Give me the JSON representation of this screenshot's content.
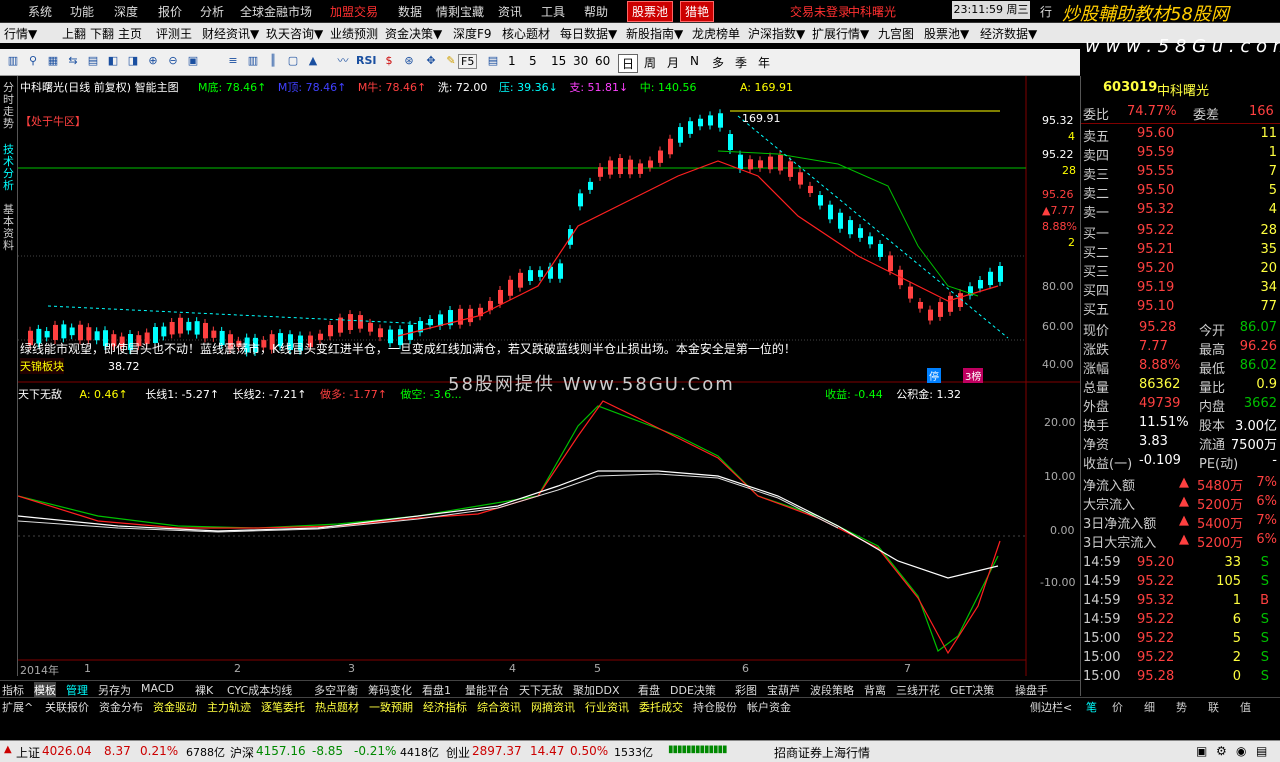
{
  "menubar": {
    "items": [
      "系统",
      "功能",
      "深度",
      "报价",
      "分析",
      "全球金融市场",
      "加盟交易",
      "数据",
      "情剩宝藏",
      "资讯",
      "工具",
      "帮助"
    ],
    "tab_stockpool": "股票池",
    "tab_hunt": "猎艳",
    "status_text": "交易未登录",
    "stock_label": "中科曙光",
    "clock": "23:11:59 周三",
    "trade": "行"
  },
  "toolbar1": [
    "行情▼",
    "上翻",
    "下翻",
    "主页",
    "评测王",
    "财经资讯▼",
    "玖天咨询▼",
    "业绩预测",
    "资金决策▼",
    "深度F9",
    "核心题材",
    "每日数据▼",
    "新股指南▼",
    "龙虎榜单",
    "沪深指数▼",
    "扩展行情▼",
    "九宫图",
    "股票池▼",
    "经济数据▼"
  ],
  "toolbar2": {
    "icons": [
      "chart-bar-icon",
      "search-icon",
      "grid-icon",
      "swap-icon",
      "line-icon",
      "rsi-icon",
      "dollar-icon",
      "target-icon",
      "cross-icon",
      "pencil-icon",
      "f5-icon",
      "doc-icon"
    ],
    "rsi": "RSI",
    "f5": "F5",
    "periods": [
      "1",
      "5",
      "15",
      "30",
      "60",
      "日",
      "周",
      "月",
      "N",
      "多",
      "季",
      "年"
    ]
  },
  "lefttabs": [
    "分时走势",
    "技术分析",
    "基本资料"
  ],
  "chart": {
    "header": "中科曙光(日线 前复权) 智能主图",
    "indicators": [
      {
        "label": "M底: 78.46↑",
        "color": "#00ff00"
      },
      {
        "label": "M顶: 78.46↑",
        "color": "#4040ff"
      },
      {
        "label": "M牛: 78.46↑",
        "color": "#ff4040"
      },
      {
        "label": "洗: 72.00",
        "color": "#ffffff"
      },
      {
        "label": "压: 39.36↓",
        "color": "#00ffff"
      },
      {
        "label": "支: 51.81↓",
        "color": "#ff40ff"
      },
      {
        "label": "中: 140.56",
        "color": "#00ff00"
      },
      {
        "label": "A: 169.91",
        "color": "#ffff00"
      }
    ],
    "bear_tag": "【处于牛区】",
    "peak_label": "169.91",
    "comment": "绿线能市观望，即使冒头也不动！蓝线震荡市，K线冒头变红进半仓，一旦变成红线加满仓，若又跌破蓝线则半仓止损出场。本金安全是第一位的！",
    "sector_label": "天锦板块",
    "low_label": "38.72",
    "watermark": "58股网提供  Www.58GU.Com",
    "right_axis": [
      "95.32",
      "4",
      "95.22",
      "28",
      "95.26",
      "▲7.77",
      "8.88%",
      "2",
      "80.00",
      "60.00",
      "40.00"
    ],
    "sub_header": "天下无敌",
    "sub_indicators": [
      {
        "label": "A: 0.46↑",
        "color": "#ffff00"
      },
      {
        "label": "长线1: -5.27↑",
        "color": "#ffffff"
      },
      {
        "label": "长线2: -7.21↑",
        "color": "#ffffff"
      },
      {
        "label": "做多: -1.77↑",
        "color": "#ff4040"
      },
      {
        "label": "做空: -3.6...",
        "color": "#00ff00"
      },
      {
        "label": "收益: -0.44",
        "color": "#00ff00"
      },
      {
        "label": "公积金: 1.32",
        "color": "#ffffff"
      }
    ],
    "sub_axis": [
      "20.00",
      "10.00",
      "0.00",
      "-10.00"
    ],
    "x_axis": [
      "2014年",
      "1",
      "2",
      "3",
      "4",
      "5",
      "6",
      "7"
    ],
    "ting_label": "停",
    "tag_3": "3榜"
  },
  "rpanel": {
    "code": "603019",
    "name": "中科曙光",
    "ratio_label": "委比",
    "ratio_value": "74.77%",
    "diff_label": "委差",
    "diff_value": "166",
    "asks": [
      {
        "label": "卖五",
        "price": "95.60",
        "vol": "11"
      },
      {
        "label": "卖四",
        "price": "95.59",
        "vol": "1"
      },
      {
        "label": "卖三",
        "price": "95.55",
        "vol": "7"
      },
      {
        "label": "卖二",
        "price": "95.50",
        "vol": "5"
      },
      {
        "label": "卖一",
        "price": "95.32",
        "vol": "4"
      }
    ],
    "bids": [
      {
        "label": "买一",
        "price": "95.22",
        "vol": "28"
      },
      {
        "label": "买二",
        "price": "95.21",
        "vol": "35"
      },
      {
        "label": "买三",
        "price": "95.20",
        "vol": "20"
      },
      {
        "label": "买四",
        "price": "95.19",
        "vol": "34"
      },
      {
        "label": "买五",
        "price": "95.10",
        "vol": "77"
      }
    ],
    "stats": [
      {
        "l1": "现价",
        "v1": "95.28",
        "c1": "#ff4040",
        "l2": "今开",
        "v2": "86.07",
        "c2": "#00c000"
      },
      {
        "l1": "涨跌",
        "v1": "7.77",
        "c1": "#ff4040",
        "l2": "最高",
        "v2": "96.26",
        "c2": "#ff4040"
      },
      {
        "l1": "涨幅",
        "v1": "8.88%",
        "c1": "#ff4040",
        "l2": "最低",
        "v2": "86.02",
        "c2": "#00c000"
      },
      {
        "l1": "总量",
        "v1": "86362",
        "c1": "#ffff40",
        "l2": "量比",
        "v2": "0.9",
        "c2": "#ffff40"
      },
      {
        "l1": "外盘",
        "v1": "49739",
        "c1": "#ff4040",
        "l2": "内盘",
        "v2": "3662",
        "c2": "#00c000"
      },
      {
        "l1": "换手",
        "v1": "11.51%",
        "c1": "#ffffff",
        "l2": "股本",
        "v2": "3.00亿",
        "c2": "#ffffff"
      },
      {
        "l1": "净资",
        "v1": "3.83",
        "c1": "#ffffff",
        "l2": "流通",
        "v2": "7500万",
        "c2": "#ffffff"
      },
      {
        "l1": "收益(一)",
        "v1": "-0.109",
        "c1": "#ffffff",
        "l2": "PE(动)",
        "v2": "-",
        "c2": "#ffffff"
      }
    ],
    "flows": [
      {
        "label": "净流入额",
        "value": "5480万",
        "pct": "7%"
      },
      {
        "label": "大宗流入",
        "value": "5200万",
        "pct": "6%"
      },
      {
        "label": "3日净流入额",
        "value": "5400万",
        "pct": "7%"
      },
      {
        "label": "3日大宗流入",
        "value": "5200万",
        "pct": "6%"
      }
    ],
    "ticks": [
      {
        "time": "14:59",
        "price": "95.20",
        "vol": "33",
        "side": "S"
      },
      {
        "time": "14:59",
        "price": "95.22",
        "vol": "105",
        "side": "S"
      },
      {
        "time": "14:59",
        "price": "95.32",
        "vol": "1",
        "side": "B"
      },
      {
        "time": "14:59",
        "price": "95.22",
        "vol": "6",
        "side": "S"
      },
      {
        "time": "15:00",
        "price": "95.22",
        "vol": "5",
        "side": "S"
      },
      {
        "time": "15:00",
        "price": "95.22",
        "vol": "2",
        "side": "S"
      },
      {
        "time": "15:00",
        "price": "95.28",
        "vol": "0",
        "side": "S"
      }
    ],
    "bottom_tabs": [
      "笔",
      "价",
      "细",
      "势",
      "联",
      "值"
    ]
  },
  "tabsbar": [
    "指标",
    "模板",
    "管理",
    "另存为",
    "MACD",
    "裸K",
    "CYC成本均线",
    "多空平衡",
    "筹码变化",
    "看盘1",
    "量能平台",
    "天下无敌",
    "聚加DDX",
    "看盘",
    "DDE决策",
    "彩图",
    "宝葫芦",
    "波段策略",
    "背离",
    "三线开花",
    "GET决策",
    "操盘手"
  ],
  "infobar": [
    "扩展^",
    "关联报价",
    "资金分布",
    "资金驱动",
    "主力轨迹",
    "逐笔委托",
    "热点题材",
    "一致预期",
    "经济指标",
    "综合资讯",
    "网摘资讯",
    "行业资讯",
    "委托成交",
    "持仓股份",
    "帐户资金"
  ],
  "infobar_right": "侧边栏<",
  "statusbar": {
    "sh_label": "上证",
    "sh_value": "4026.04",
    "sh_chg": "8.37",
    "sh_pct": "0.21%",
    "sh_amt": "6788亿",
    "sz_label": "沪深",
    "sz_value": "4157.16",
    "sz_chg": "-8.85",
    "sz_pct": "-0.21%",
    "sz_amt": "4418亿",
    "cy_label": "创业",
    "cy_value": "2897.37",
    "cy_chg": "14.47",
    "cy_pct": "0.50%",
    "cy_amt": "1533亿",
    "broker": "招商证券上海行情"
  }
}
